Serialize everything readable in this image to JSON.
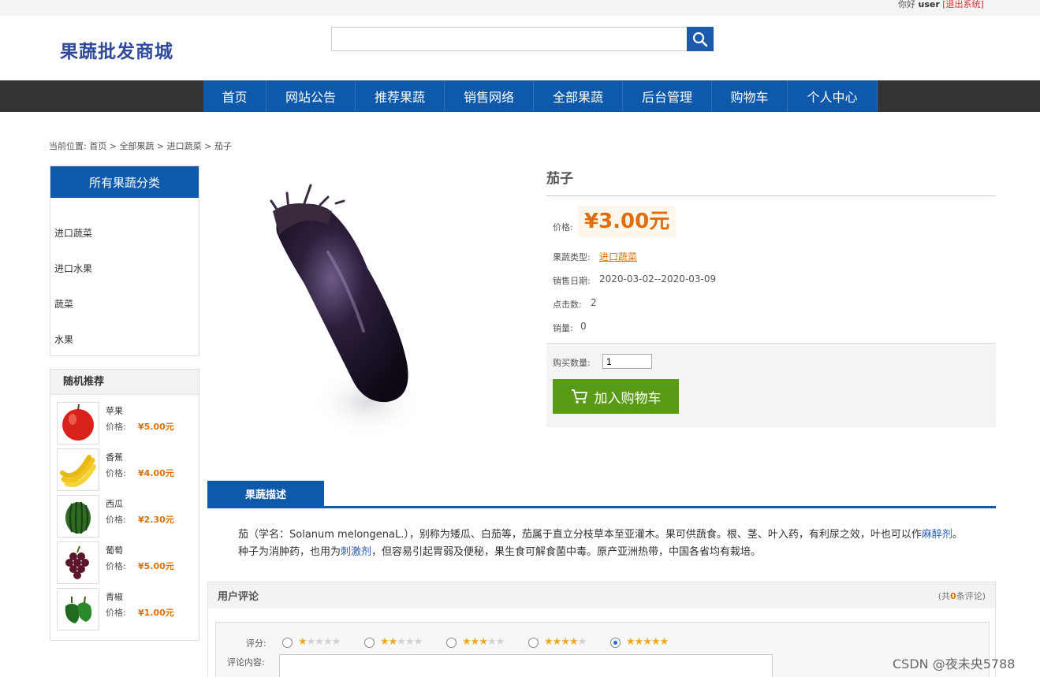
{
  "topbar": {
    "greeting": "你好",
    "user": "user",
    "logout": "[退出系统]"
  },
  "header": {
    "logo": "果蔬批发商城",
    "search_value": ""
  },
  "nav": {
    "items": [
      "首页",
      "网站公告",
      "推荐果蔬",
      "销售网络",
      "全部果蔬",
      "后台管理",
      "购物车",
      "个人中心"
    ]
  },
  "breadcrumb": {
    "prefix": "当前位置:",
    "items": [
      "首页",
      "全部果蔬",
      "进口蔬菜",
      "茄子"
    ]
  },
  "categories": {
    "title": "所有果蔬分类",
    "items": [
      "进口蔬菜",
      "进口水果",
      "蔬菜",
      "水果"
    ]
  },
  "recommend": {
    "title": "随机推荐",
    "price_label": "价格:",
    "items": [
      {
        "name": "苹果",
        "price": "¥5.00元"
      },
      {
        "name": "香蕉",
        "price": "¥4.00元"
      },
      {
        "name": "西瓜",
        "price": "¥2.30元"
      },
      {
        "name": "葡萄",
        "price": "¥5.00元"
      },
      {
        "name": "青椒",
        "price": "¥1.00元"
      }
    ]
  },
  "product": {
    "name": "茄子",
    "price_label": "价格:",
    "price": "¥3.00元",
    "type_label": "果蔬类型:",
    "type": "进口蔬菜",
    "date_label": "销售日期:",
    "date": "2020-03-02--2020-03-09",
    "clicks_label": "点击数:",
    "clicks": "2",
    "sales_label": "销量:",
    "sales": "0",
    "qty_label": "购买数量:",
    "qty": "1",
    "cart_button": "加入购物车"
  },
  "description": {
    "tab": "果蔬描述",
    "part1": "茄（学名：Solanum melongenaL.），别称为矮瓜、白茄等，茄属于直立分枝草本至亚灌木。果可供蔬食。根、茎、叶入药，有利尿之效，叶也可以作",
    "link1": "麻醉剂",
    "part2": "。种子为消肿药，也用为",
    "link2": "刺激剂",
    "part3": "，但容易引起胃弱及便秘，果生食可解食菌中毒。原产亚洲热带，中国各省均有栽培。"
  },
  "reviews": {
    "title": "用户评论",
    "count_prefix": "(共",
    "count": "0",
    "count_suffix": "条评论)",
    "rating_label": "评分:",
    "content_label": "评论内容:",
    "ratings": [
      1,
      2,
      3,
      4,
      5
    ],
    "selected_rating": 5
  },
  "watermark": "CSDN @夜未央5788",
  "colors": {
    "nav_blue": "#0e59aa",
    "price_orange": "#e06d10",
    "cart_green": "#5a9b16"
  }
}
